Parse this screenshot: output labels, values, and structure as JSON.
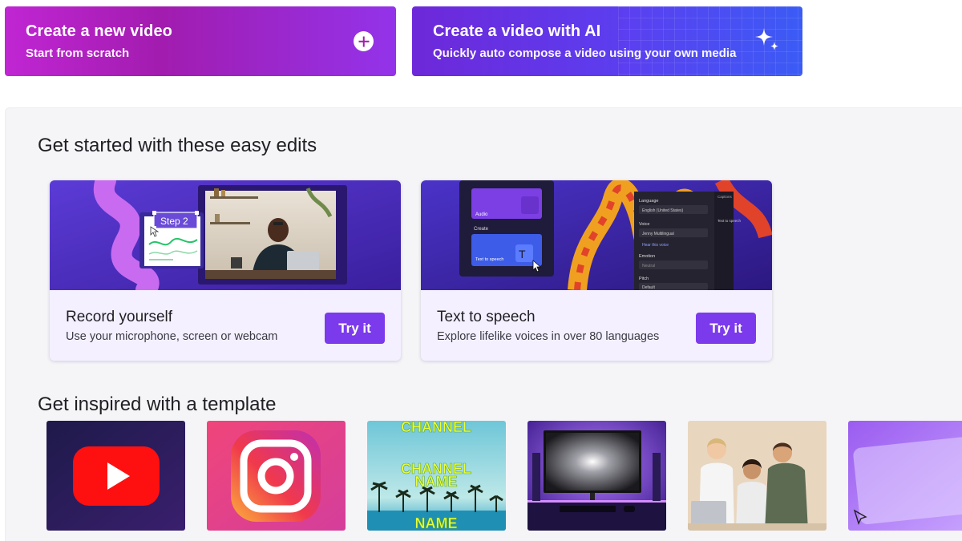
{
  "hero": {
    "new_video": {
      "title": "Create a new video",
      "subtitle": "Start from scratch"
    },
    "ai_video": {
      "title": "Create a video with AI",
      "subtitle": "Quickly auto compose a video using your own media"
    }
  },
  "easy_edits": {
    "title": "Get started with these easy edits",
    "cards": [
      {
        "title": "Record yourself",
        "desc": "Use your microphone, screen or webcam",
        "button": "Try it",
        "thumb_label": "Step 2"
      },
      {
        "title": "Text to speech",
        "desc": "Explore lifelike voices in over 80 languages",
        "button": "Try it",
        "thumb": {
          "left_labels": [
            "Audio",
            "Create",
            "Text to speech"
          ],
          "field_labels": [
            "Language",
            "Voice",
            "Emotion",
            "Pitch"
          ],
          "field_values": [
            "English (United States)",
            "Jenny Multilingual",
            "Neutral",
            "Default"
          ],
          "hear_link": "Hear this voice",
          "side_tab": "Captions",
          "side_label": "Text to speech"
        }
      }
    ]
  },
  "templates": {
    "title": "Get inspired with a template",
    "channel_text": [
      "CHANNEL",
      "NAME"
    ]
  },
  "colors": {
    "accent": "#7c3aed",
    "hero_new": "#a21caf",
    "hero_ai": "#5b3ff0"
  }
}
